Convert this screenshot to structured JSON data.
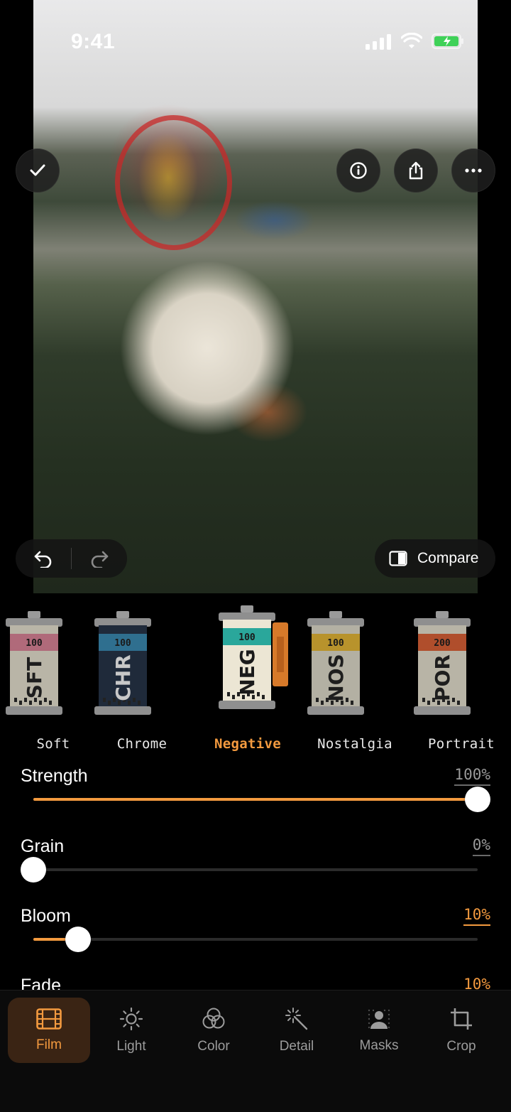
{
  "status_bar": {
    "time": "9:41"
  },
  "toolbar": {
    "compare_label": "Compare"
  },
  "films": [
    {
      "code": "SFT",
      "iso": "100",
      "name": "Soft",
      "band_color": "#b06a7a",
      "body_color": "#b9b5a7",
      "text_color": "#1e1e1e",
      "active": false
    },
    {
      "code": "CHR",
      "iso": "100",
      "name": "Chrome",
      "band_color": "#2f6f8f",
      "body_color": "#1f2a3a",
      "text_color": "#c8c8c8",
      "active": false
    },
    {
      "code": "NEG",
      "iso": "100",
      "name": "Negative",
      "band_color": "#2aa79b",
      "body_color": "#ece6d4",
      "text_color": "#1a1a1a",
      "active": true
    },
    {
      "code": "NOS",
      "iso": "100",
      "name": "Nostalgia",
      "band_color": "#b8932c",
      "body_color": "#b3b0a3",
      "text_color": "#1e1e1e",
      "active": false
    },
    {
      "code": "POR",
      "iso": "200",
      "name": "Portrait",
      "band_color": "#b04e2c",
      "body_color": "#b8b4a6",
      "text_color": "#1e1e1e",
      "active": false
    }
  ],
  "sliders": [
    {
      "label": "Strength",
      "value_text": "100%",
      "value": 100,
      "accent": false
    },
    {
      "label": "Grain",
      "value_text": "0%",
      "value": 0,
      "accent": false
    },
    {
      "label": "Bloom",
      "value_text": "10%",
      "value": 10,
      "accent": true
    },
    {
      "label": "Fade",
      "value_text": "10%",
      "value": 10,
      "accent": true
    }
  ],
  "tabs": [
    {
      "label": "Film",
      "icon": "film-icon",
      "active": true
    },
    {
      "label": "Light",
      "icon": "sun-icon",
      "active": false
    },
    {
      "label": "Color",
      "icon": "color-circles-icon",
      "active": false
    },
    {
      "label": "Detail",
      "icon": "sparkle-wand-icon",
      "active": false
    },
    {
      "label": "Masks",
      "icon": "mask-person-icon",
      "active": false
    },
    {
      "label": "Crop",
      "icon": "crop-icon",
      "active": false
    }
  ],
  "colors": {
    "accent": "#f39a3f",
    "background": "#000000"
  }
}
